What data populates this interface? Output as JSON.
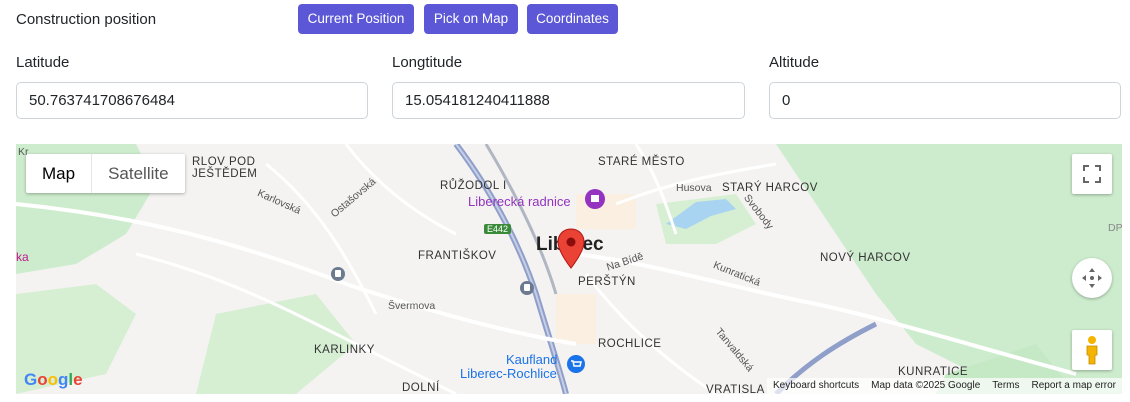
{
  "header": {
    "section_label": "Construction position",
    "buttons": {
      "current": "Current Position",
      "pick": "Pick on Map",
      "coords": "Coordinates"
    }
  },
  "fields": {
    "latitude": {
      "label": "Latitude",
      "value": "50.763741708676484"
    },
    "longitude": {
      "label": "Longtitude",
      "value": "15.054181240411888"
    },
    "altitude": {
      "label": "Altitude",
      "value": "0"
    }
  },
  "map": {
    "type_buttons": {
      "map": "Map",
      "satellite": "Satellite"
    },
    "city": "Liberec",
    "labels": {
      "harlov": "RLOV POD",
      "jestedem": "JEŠTĚDEM",
      "stare_mesto": "STARÉ MĚSTO",
      "ruzodol": "RŮŽODOL I",
      "radnice": "Liberecká radnice",
      "husova": "Husova",
      "stary_harcov": "STARÝ HARCOV",
      "svobody": "Svobody",
      "karlovska": "Karlovská",
      "ostasovska": "Ostašovská",
      "e442": "E442",
      "frantiskov": "FRANTIŠKOV",
      "na_bide": "Na Bídě",
      "kunraticka": "Kunratická",
      "novy_harcov": "NOVÝ HARCOV",
      "perstyn": "PERŠTÝN",
      "svermova": "Švermova",
      "karlinky": "KARLINKY",
      "rochlice": "ROCHLICE",
      "tanvaldska": "Tanvaldská",
      "kaufland1": "Kaufland",
      "kaufland2": "Liberec-Rochlice",
      "dolni": "DOLNÍ",
      "vratisla": "VRATISLA",
      "kunratice": "KUNRATICE",
      "dp": "DP",
      "left_ka": "ka",
      "left_top": "Kr"
    },
    "google_logo": "Google",
    "attribution": {
      "shortcuts": "Keyboard shortcuts",
      "data": "Map data ©2025 Google",
      "terms": "Terms",
      "report": "Report a map error"
    },
    "colors": {
      "accent": "#5b57d6",
      "marker": "#ea4335",
      "park": "#cdeccd",
      "water": "#a8d4f2",
      "highway": "#8f9fc9"
    }
  }
}
